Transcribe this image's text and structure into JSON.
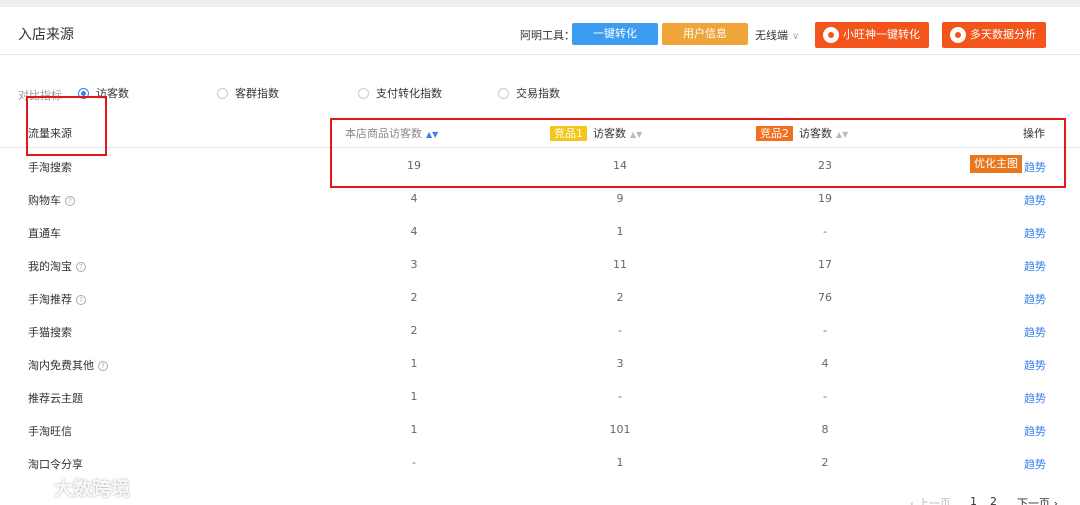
{
  "header": {
    "title": "入店来源",
    "tools_label": "阿明工具：",
    "btn_convert": "一键转化",
    "btn_userinfo": "用户信息",
    "device_select": "无线端",
    "btn_xiaowang": "小旺神一键转化",
    "btn_multiday": "多天数据分析"
  },
  "metrics": {
    "label": "对比指标",
    "options": [
      "访客数",
      "客群指数",
      "支付转化指数",
      "交易指数"
    ],
    "selected": "访客数"
  },
  "table": {
    "headers": {
      "source": "流量来源",
      "own_visitors": "本店商品访客数",
      "comp1_badge": "竞品1",
      "comp1_label": "访客数",
      "comp2_badge": "竞品2",
      "comp2_label": "访客数",
      "action": "操作"
    },
    "trend_label": "趋势",
    "optimize_label": "优化主图",
    "rows": [
      {
        "source": "手淘搜索",
        "help": false,
        "own": "19",
        "c1": "14",
        "c2": "23",
        "optimize": true
      },
      {
        "source": "购物车",
        "help": true,
        "own": "4",
        "c1": "9",
        "c2": "19",
        "optimize": false
      },
      {
        "source": "直通车",
        "help": false,
        "own": "4",
        "c1": "1",
        "c2": "-",
        "optimize": false
      },
      {
        "source": "我的淘宝",
        "help": true,
        "own": "3",
        "c1": "11",
        "c2": "17",
        "optimize": false
      },
      {
        "source": "手淘推荐",
        "help": true,
        "own": "2",
        "c1": "2",
        "c2": "76",
        "optimize": false
      },
      {
        "source": "手猫搜索",
        "help": false,
        "own": "2",
        "c1": "-",
        "c2": "-",
        "optimize": false
      },
      {
        "source": "淘内免费其他",
        "help": true,
        "own": "1",
        "c1": "3",
        "c2": "4",
        "optimize": false
      },
      {
        "source": "推荐云主题",
        "help": false,
        "own": "1",
        "c1": "-",
        "c2": "-",
        "optimize": false
      },
      {
        "source": "手淘旺信",
        "help": false,
        "own": "1",
        "c1": "101",
        "c2": "8",
        "optimize": false
      },
      {
        "source": "淘口令分享",
        "help": false,
        "own": "-",
        "c1": "1",
        "c2": "2",
        "optimize": false
      }
    ]
  },
  "pager": {
    "prev": "‹ 上一页",
    "pages": [
      "1",
      "2"
    ],
    "next": "下一页 ›"
  },
  "watermark": {
    "text": "大数跨境"
  },
  "colors": {
    "accent_blue": "#3b7ff0",
    "btn_blue": "#3b9cf0",
    "btn_orange": "#f0a53a",
    "btn_red": "#f2541b",
    "annotation_red": "#e01818"
  }
}
